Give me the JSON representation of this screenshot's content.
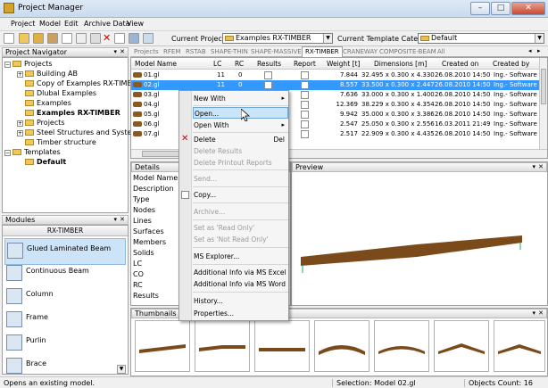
{
  "window": {
    "title": "Project Manager"
  },
  "menu": [
    "Project",
    "Model",
    "Edit",
    "Archive Data",
    "View"
  ],
  "toolbar": {
    "current_project_label": "Current Project:",
    "current_project_value": "Examples RX-TIMBER",
    "template_category_label": "Current Template Category",
    "template_category_value": "Default"
  },
  "navigator": {
    "title": "Project Navigator",
    "root": "Projects",
    "items": [
      "Building AB",
      "Copy of Examples RX-TIMBER",
      "Dlubal Examples",
      "Examples",
      "Examples RX-TIMBER",
      "Projects",
      "Steel Structures and Systems",
      "Timber structure"
    ],
    "templates": "Templates",
    "default": "Default"
  },
  "modules": {
    "title": "Modules",
    "group": "RX-TIMBER",
    "items": [
      "Glued Laminated Beam",
      "Continuous Beam",
      "Column",
      "Frame",
      "Purlin",
      "Brace"
    ]
  },
  "tabs": [
    "Projects",
    "RFEM",
    "RSTAB",
    "SHAPE-THIN",
    "SHAPE-MASSIVE",
    "RX-TIMBER",
    "CRANEWAY",
    "COMPOSITE-BEAM",
    "All"
  ],
  "table": {
    "headers": [
      "Model Name",
      "LC",
      "RC",
      "Results",
      "Report",
      "Weight [t]",
      "Dimensions [m]",
      "Created on",
      "Created by"
    ],
    "rows": [
      {
        "name": "01.gl",
        "lc": "11",
        "rc": "0",
        "weight": "7.844",
        "dims": "32.495 x 0.300 x 4.330",
        "created": "26.08.2010 14:50",
        "by": "Ing.- Software D"
      },
      {
        "name": "02.gl",
        "lc": "11",
        "rc": "0",
        "weight": "8.557",
        "dims": "33.500 x 0.300 x 2.447",
        "created": "26.08.2010 14:50",
        "by": "Ing.- Software D"
      },
      {
        "name": "03.gl",
        "lc": "",
        "rc": "",
        "weight": "7.636",
        "dims": "33.000 x 0.300 x 1.400",
        "created": "26.08.2010 14:50",
        "by": "Ing.- Software D"
      },
      {
        "name": "04.gl",
        "lc": "",
        "rc": "",
        "weight": "12.369",
        "dims": "38.229 x 0.300 x 4.354",
        "created": "26.08.2010 14:50",
        "by": "Ing.- Software D"
      },
      {
        "name": "05.gl",
        "lc": "",
        "rc": "",
        "weight": "9.942",
        "dims": "35.000 x 0.300 x 3.386",
        "created": "26.08.2010 14:50",
        "by": "Ing.- Software D"
      },
      {
        "name": "06.gl",
        "lc": "",
        "rc": "",
        "weight": "2.547",
        "dims": "25.050 x 0.300 x 2.556",
        "created": "16.03.2011 21:49",
        "by": "Ing.- Software D"
      },
      {
        "name": "07.gl",
        "lc": "",
        "rc": "",
        "weight": "2.517",
        "dims": "22.909 x 0.300 x 4.435",
        "created": "26.08.2010 14:50",
        "by": "Ing.- Software D"
      }
    ]
  },
  "details": {
    "title": "Details",
    "labels": [
      "Model Name",
      "Description",
      "Type",
      "Nodes",
      "Lines",
      "Surfaces",
      "Members",
      "Solids",
      "LC",
      "CO",
      "RC",
      "Results"
    ]
  },
  "preview": {
    "title": "Preview"
  },
  "thumbnails": {
    "title": "Thumbnails"
  },
  "context_menu": [
    {
      "label": "New With",
      "arrow": "▸",
      "disabled": false
    },
    {
      "label": "Open...",
      "highlight": true,
      "disabled": false
    },
    {
      "label": "Open With",
      "arrow": "▸",
      "disabled": false
    },
    {
      "label": "Delete",
      "shortcut": "Del",
      "disabled": false
    },
    {
      "label": "Delete Results",
      "disabled": true
    },
    {
      "label": "Delete Printout Reports",
      "disabled": true
    },
    {
      "label": "Send...",
      "disabled": true
    },
    {
      "label": "Copy...",
      "disabled": false
    },
    {
      "label": "Archive...",
      "disabled": true
    },
    {
      "label": "Set as 'Read Only'",
      "disabled": true
    },
    {
      "label": "Set as 'Not Read Only'",
      "disabled": true
    },
    {
      "label": "MS Explorer...",
      "disabled": false
    },
    {
      "label": "Additional Info via MS Excel",
      "disabled": false
    },
    {
      "label": "Additional Info via MS Word",
      "disabled": false
    },
    {
      "label": "History...",
      "disabled": false
    },
    {
      "label": "Properties...",
      "disabled": false
    }
  ],
  "status": {
    "hint": "Opens an existing model.",
    "selection": "Selection: Model 02.gl",
    "count": "Objects Count: 16"
  },
  "colors": {
    "selection": "#3399ff",
    "beam": "#7a4a1a",
    "highlight": "#cce4f7"
  }
}
